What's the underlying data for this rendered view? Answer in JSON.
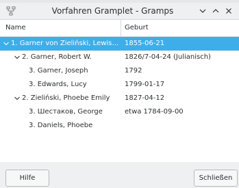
{
  "window": {
    "title": "Vorfahren Gramplet - Gramps",
    "background_text": "..."
  },
  "colors": {
    "accent": "#3daee9",
    "selected_text": "#ffffff"
  },
  "columns": {
    "name": "Name",
    "geburt": "Geburt"
  },
  "rows": [
    {
      "name": "1. Garner von Zieliński, Lewis An...",
      "date": "1855-06-21",
      "expanded": true,
      "selected": true
    },
    {
      "name": "2. Garner, Robert W.",
      "date": "1826/7-04-24 (Julianisch)",
      "expanded": true,
      "selected": false
    },
    {
      "name": "3. Garner, Joseph",
      "date": "1792",
      "expanded": false,
      "selected": false
    },
    {
      "name": "3. Edwards, Lucy",
      "date": "1799-01-17",
      "expanded": false,
      "selected": false
    },
    {
      "name": "2. Zieliński, Phoebe Emily",
      "date": "1827-04-12",
      "expanded": true,
      "selected": false
    },
    {
      "name": "3. Шестаков, George",
      "date": "etwa 1784-09-00",
      "expanded": false,
      "selected": false
    },
    {
      "name": "3. Daniels, Phoebe",
      "date": "",
      "expanded": false,
      "selected": false
    }
  ],
  "buttons": {
    "help": "Hilfe",
    "close": "Schließen"
  },
  "icons": {
    "app": "gramps-icon",
    "minimize": "chevron-down-icon",
    "maximize": "chevron-up-icon",
    "close": "close-icon",
    "expander": "chevron-down-icon"
  }
}
